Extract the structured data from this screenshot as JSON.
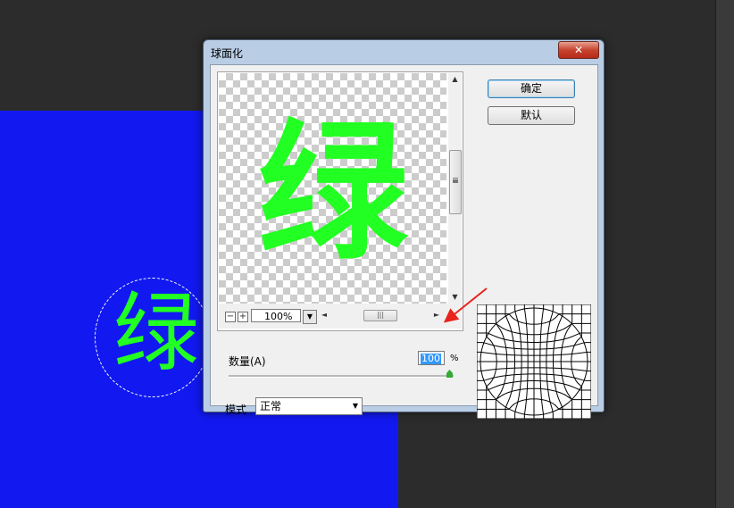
{
  "background": {
    "canvas_char": "绿",
    "canvas_color": "#1119f0",
    "glyph_color": "#22ff22"
  },
  "dialog": {
    "title": "球面化",
    "close_label": "✕",
    "ok_label": "确定",
    "default_label": "默认",
    "preview": {
      "char": "绿",
      "zoom": "100%",
      "zoom_out_label": "−",
      "zoom_in_label": "+"
    },
    "amount": {
      "label": "数量(A)",
      "value": "100",
      "unit": "%",
      "slider_fraction": 1.0
    },
    "mode": {
      "label": "模式",
      "selected": "正常"
    }
  },
  "colors": {
    "title_bar": "#b9cde5",
    "close_button": "#c7442f",
    "annotation_arrow": "#e8231b",
    "selection_highlight": "#3399ff"
  }
}
